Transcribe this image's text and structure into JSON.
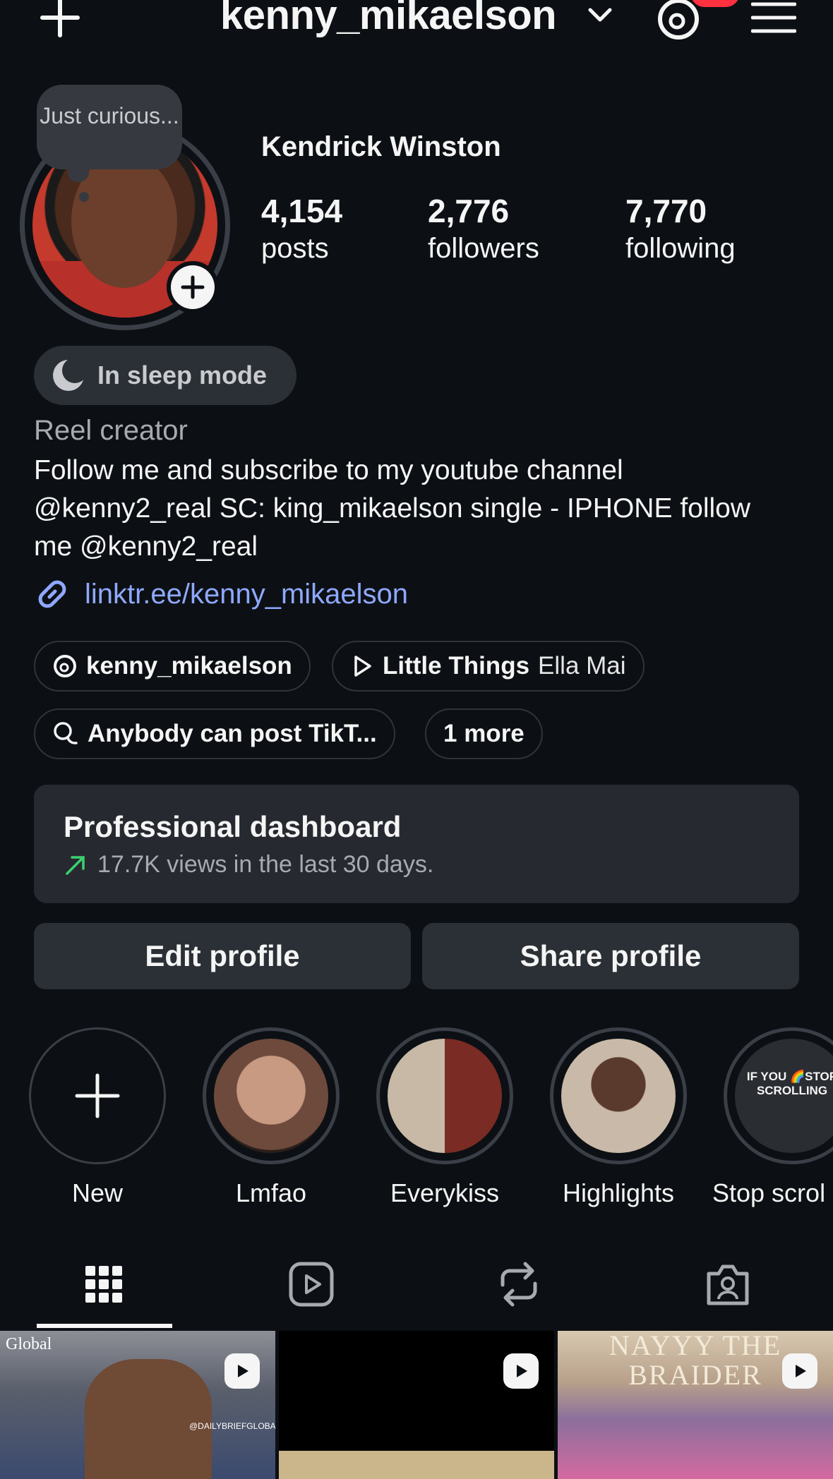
{
  "header": {
    "username": "kenny_mikaelson"
  },
  "profile": {
    "note": "Just curious...",
    "display_name": "Kendrick Winston",
    "stats": [
      {
        "value": "4,154",
        "label": "posts"
      },
      {
        "value": "2,776",
        "label": "followers"
      },
      {
        "value": "7,770",
        "label": "following"
      }
    ],
    "status": "In sleep mode",
    "category": "Reel creator",
    "bio": "Follow me and subscribe to my youtube channel @kenny2_real SC: king_mikaelson single - IPHONE follow me @kenny2_real",
    "link": "linktr.ee/kenny_mikaelson"
  },
  "chips": {
    "threads": "kenny_mikaelson",
    "music_title": "Little Things",
    "music_artist": "Ella Mai",
    "community": "Anybody can post TikT...",
    "more": "1 more"
  },
  "dashboard": {
    "title": "Professional dashboard",
    "subtitle": "17.7K views in the last 30 days.",
    "trend_color": "#3bd16f"
  },
  "actions": {
    "edit": "Edit profile",
    "share": "Share profile"
  },
  "highlights": [
    {
      "label": "New"
    },
    {
      "label": "Lmfao"
    },
    {
      "label": "Everykiss"
    },
    {
      "label": "Highlights"
    },
    {
      "label": "Stop scrol"
    }
  ],
  "highlight_text": {
    "stop_scrolling": "IF YOU 🌈STOP SCROLLING"
  },
  "tabs": [
    "grid-icon",
    "reels-icon",
    "reposts-icon",
    "tagged-icon"
  ],
  "grid": {
    "cell1_brand": "Global",
    "cell1_handle": "@DAILYBRIEFGLOBAL",
    "cell3_text": "NAYYY THE BRAIDER"
  },
  "colors": {
    "background": "#0c1014",
    "link": "#8fa8ff",
    "badge": "#ff3040"
  }
}
